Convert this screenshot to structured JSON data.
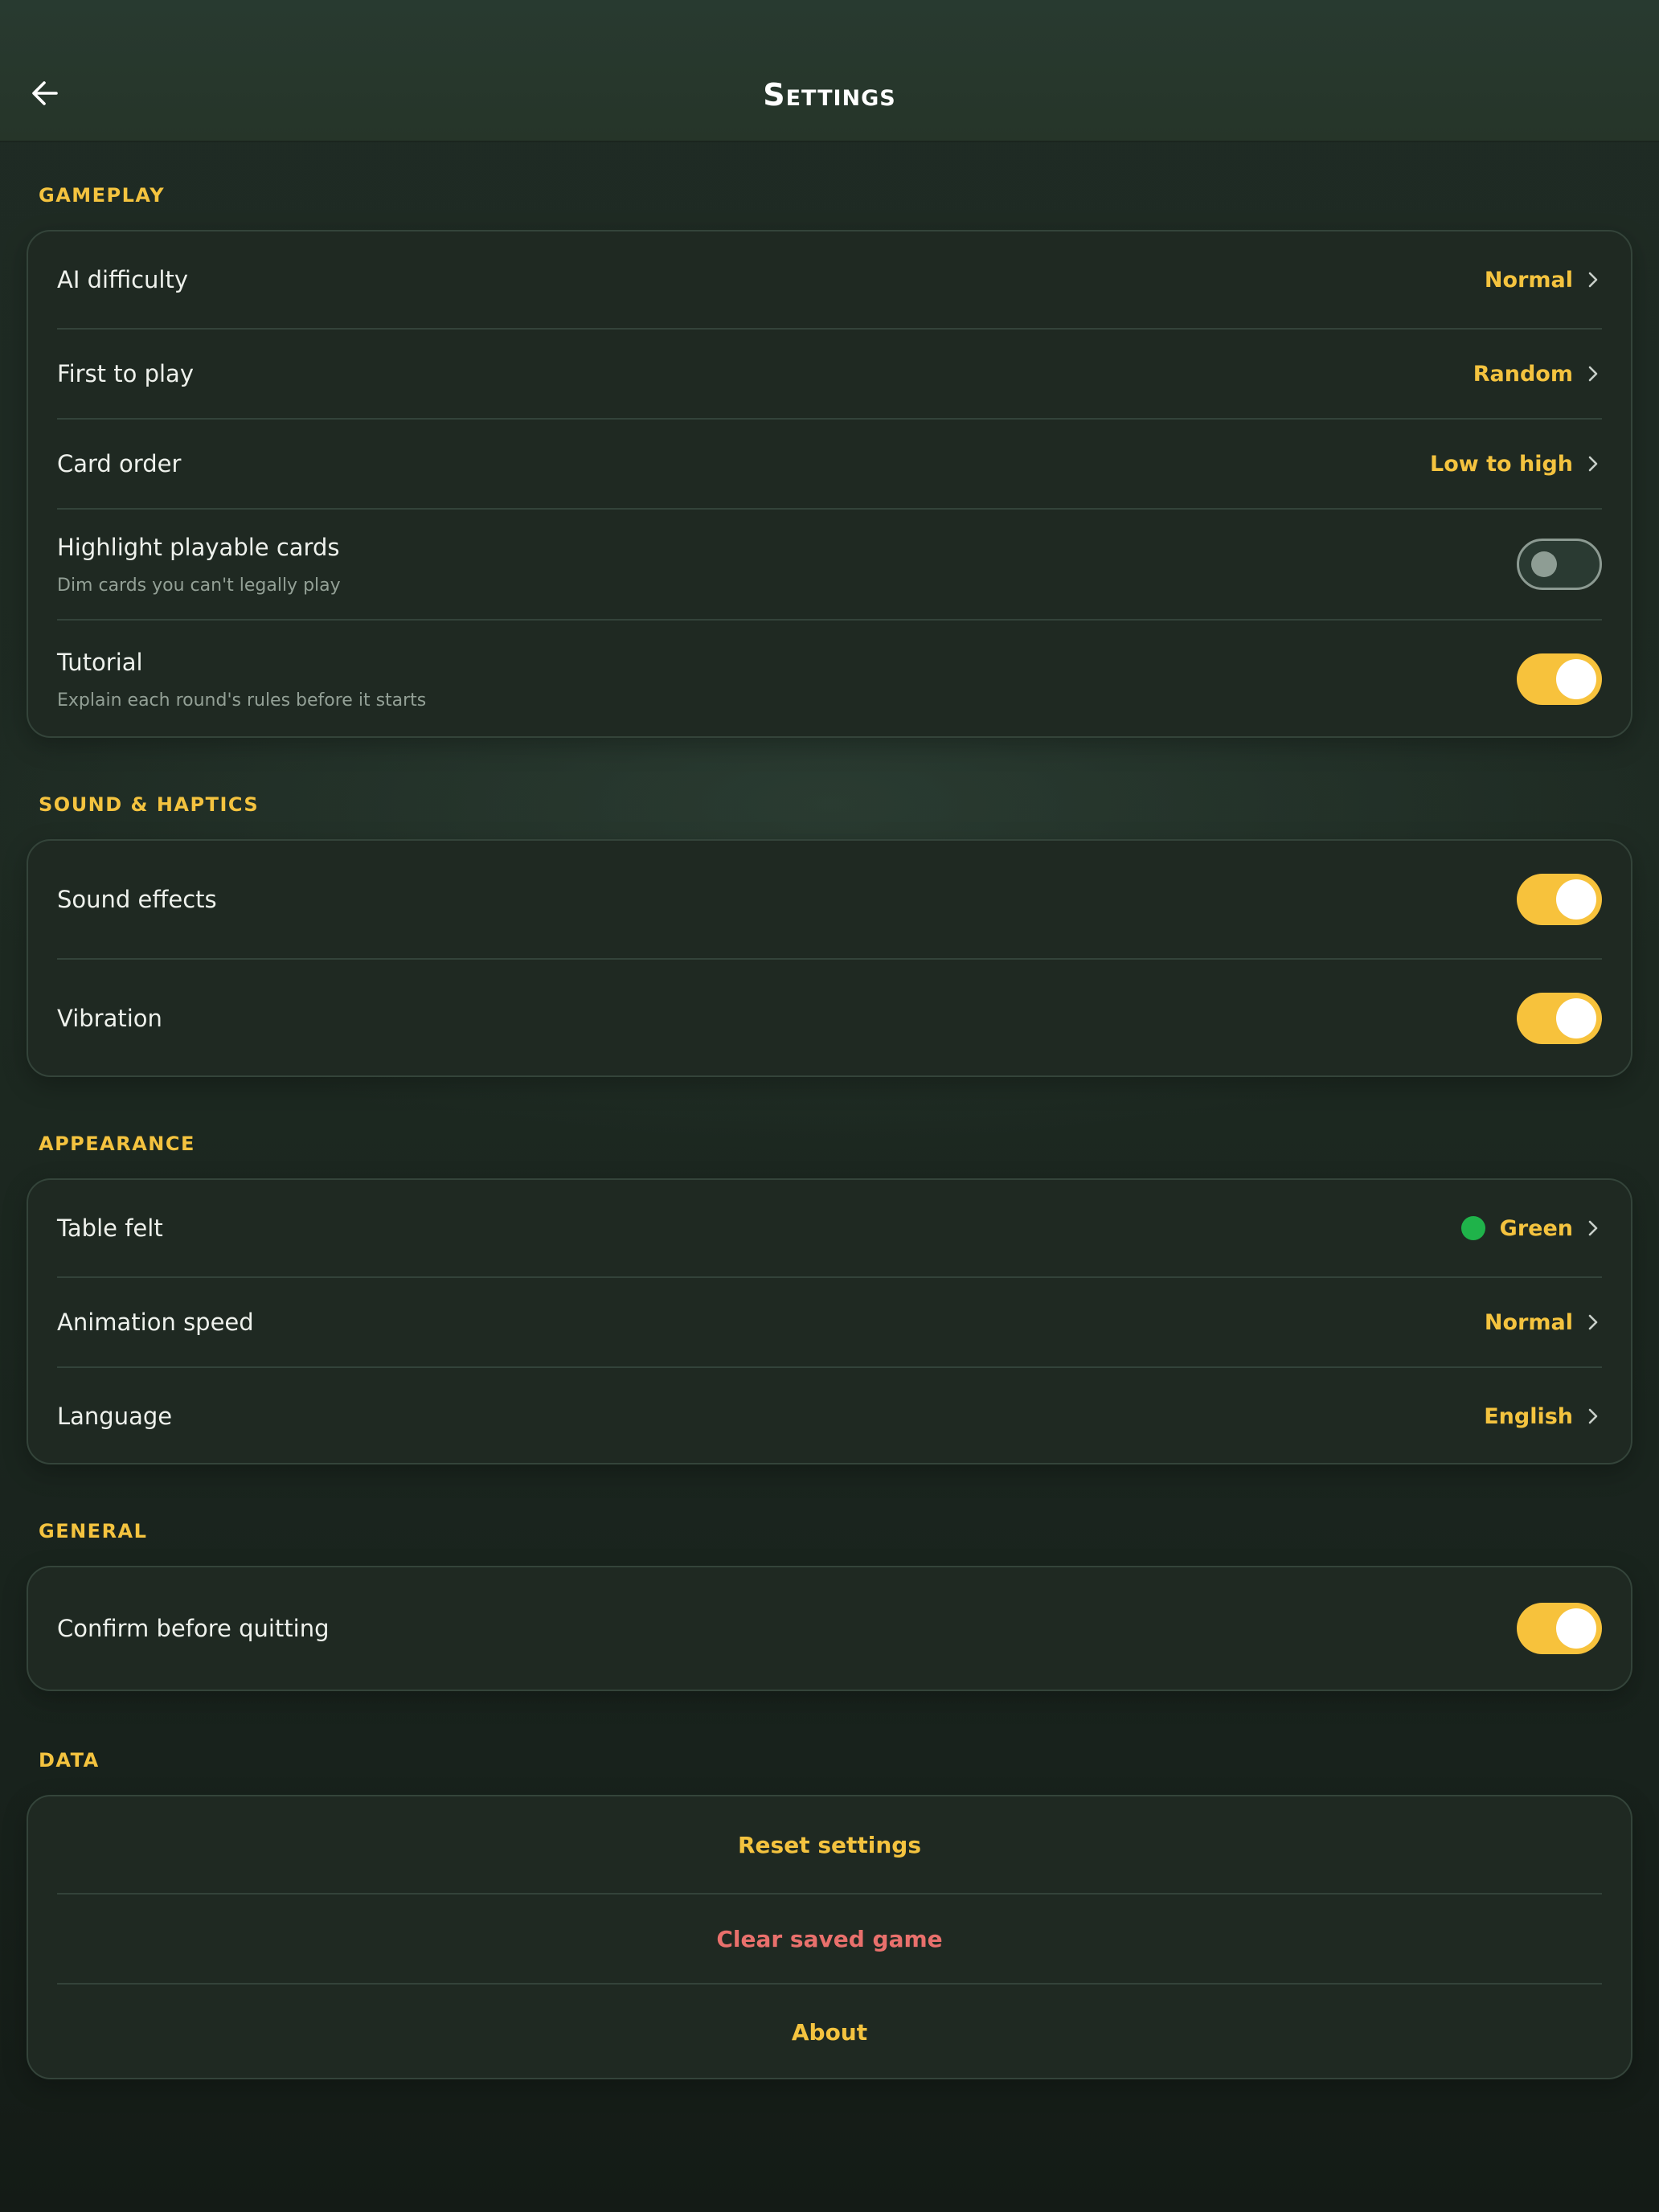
{
  "header": {
    "title": "Settings",
    "back_icon": "arrow-left-icon"
  },
  "colors": {
    "accent": "#f4c33f",
    "danger": "#e9706c",
    "felt_swatch": "#1fb34a"
  },
  "sections": {
    "gameplay": {
      "label": "GAMEPLAY",
      "ai_difficulty": {
        "label": "AI difficulty",
        "value": "Normal"
      },
      "first_to_play": {
        "label": "First to play",
        "value": "Random"
      },
      "card_order": {
        "label": "Card order",
        "value": "Low to high"
      },
      "highlight_playable": {
        "label": "Highlight playable cards",
        "sub": "Dim cards you can't legally play",
        "on": false
      },
      "tutorial": {
        "label": "Tutorial",
        "sub": "Explain each round's rules before it starts",
        "on": true
      }
    },
    "sound": {
      "label": "SOUND & HAPTICS",
      "sound_effects": {
        "label": "Sound effects",
        "on": true
      },
      "vibration": {
        "label": "Vibration",
        "on": true
      }
    },
    "appearance": {
      "label": "APPEARANCE",
      "table_felt": {
        "label": "Table felt",
        "value": "Green"
      },
      "animation_speed": {
        "label": "Animation speed",
        "value": "Normal"
      },
      "language": {
        "label": "Language",
        "value": "English"
      }
    },
    "general": {
      "label": "GENERAL",
      "confirm_quit": {
        "label": "Confirm before quitting",
        "on": true
      }
    },
    "data": {
      "label": "DATA",
      "reset": "Reset settings",
      "clear": "Clear saved game",
      "about": "About"
    }
  }
}
